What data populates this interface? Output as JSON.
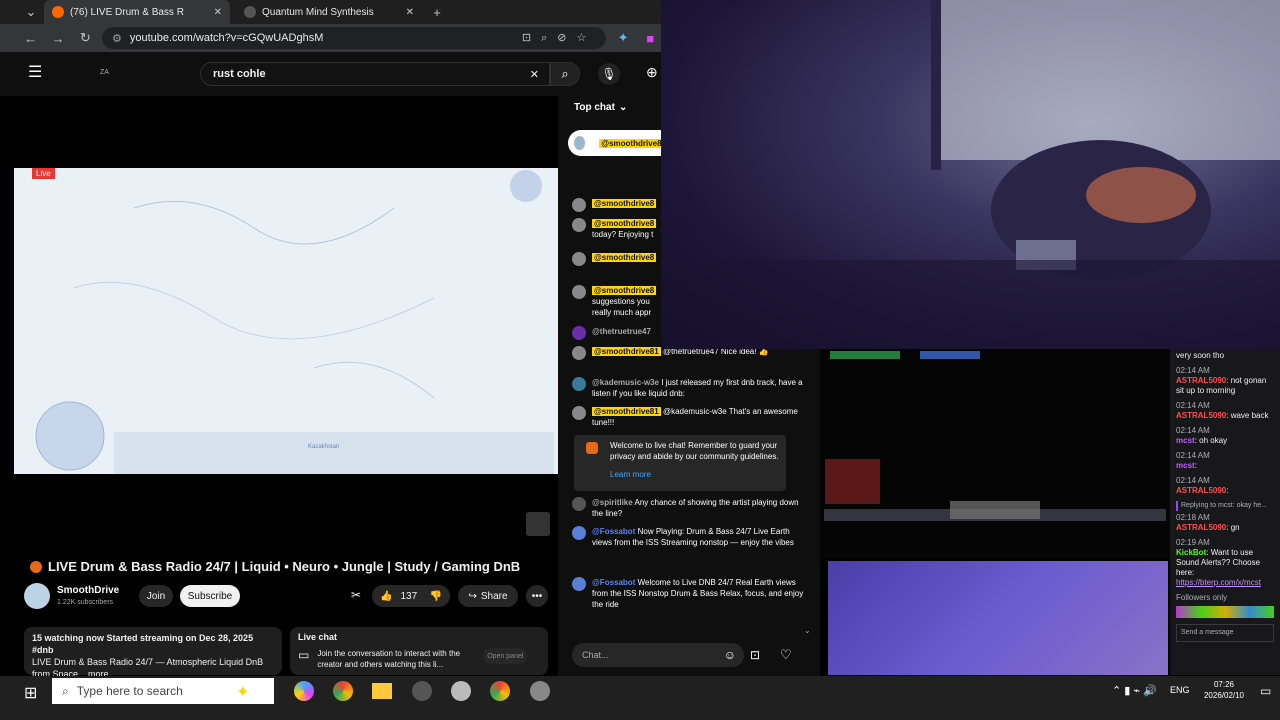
{
  "browser": {
    "tabs": [
      {
        "label": "(76) LIVE Drum & Bass R",
        "active": true
      },
      {
        "label": "Quantum Mind Synthesis",
        "active": false
      }
    ],
    "url": "youtube.com/watch?v=cGQwUADghsM"
  },
  "youtube": {
    "search_value": "rust cohle",
    "live_badge": "Live",
    "title": "LIVE Drum & Bass Radio 24/7 | Liquid • Neuro • Jungle | Study / Gaming DnB",
    "channel_name": "SmoothDrive",
    "subscribers": "1.22K subscribers",
    "join_label": "Join",
    "subscribe_label": "Subscribe",
    "likes": "137",
    "share_label": "Share",
    "description_line1": "15 watching now  Started streaming on Dec 28, 2025  #dnb",
    "description_line2": "LIVE Drum & Bass Radio 24/7 — Atmospheric Liquid DnB",
    "description_line3": "from Space  ...more",
    "live_chat_title": "Live chat",
    "live_chat_text": "Join the conversation to interact with the creator and others watching this li...",
    "live_chat_button": "Open panel",
    "map_label": "Kazakhstan"
  },
  "chat": {
    "header": "Top chat",
    "input_placeholder": "Chat...",
    "pinned_name": "@smoothdrive81",
    "messages": [
      {
        "name": "@smoothdrive8",
        "text": "",
        "hl": true
      },
      {
        "name": "@smoothdrive8",
        "text": "today? Enjoying t",
        "hl": true
      },
      {
        "name": "@smoothdrive8",
        "text": "",
        "hl": true
      },
      {
        "name": "@smoothdrive8",
        "text": "suggestions you really much appr",
        "hl": true
      },
      {
        "name": "@thetruetrue47",
        "text": "",
        "hl": false
      },
      {
        "name": "@smoothdrive81",
        "text": "@thetruetrue47 Nice idea! 👍",
        "hl": true
      },
      {
        "name": "@kademusic-w3e",
        "text": "I just released my first dnb track, have a listen if you like liquid dnb:",
        "hl": false
      },
      {
        "name": "@smoothdrive81",
        "text": "@kademusic-w3e That's an awesome tune!!!",
        "hl": true
      }
    ],
    "welcome_text": "Welcome to live chat! Remember to guard your privacy and abide by our community guidelines.",
    "learn_more": "Learn more",
    "late_messages": [
      {
        "name": "@spiritlike",
        "text": "Any chance of showing the artist playing down the line?"
      },
      {
        "name": "@Fossabot",
        "text": "Now Playing: Drum & Bass 24/7  Live Earth views from the ISS  Streaming nonstop — enjoy the vibes"
      },
      {
        "name": "@Fossabot",
        "text": "Welcome to Live DNB 24/7 Real Earth views from the ISS  Nonstop Drum & Bass  Relax, focus, and enjoy the ride"
      }
    ]
  },
  "twitch": {
    "top_text": "very soon tho",
    "messages": [
      {
        "time": "02:14 AM",
        "name": "ASTRAL5090",
        "text": "not gonan sit up to morning",
        "color": "#ff4f4f"
      },
      {
        "time": "02:14 AM",
        "name": "ASTRAL5090",
        "text": "wave back",
        "color": "#ff4f4f"
      },
      {
        "time": "02:14 AM",
        "name": "mcst",
        "text": "oh okay",
        "color": "#c05cff"
      },
      {
        "time": "02:14 AM",
        "name": "mcst",
        "text": "",
        "color": "#c05cff"
      },
      {
        "time": "02:14 AM",
        "name": "ASTRAL5090",
        "text": "",
        "color": "#ff4f4f"
      }
    ],
    "reply_label": "Replying to mcst: okay he...",
    "reply_time": "02:18 AM",
    "reply_name": "ASTRAL5090",
    "reply_text": "gn",
    "kick_time": "02:19 AM",
    "kick_name": "KickBot",
    "kick_text": "Want to use Sound Alerts?? Choose here:",
    "kick_link": "https://bterp.com/x/mcst",
    "followers_only": "Followers only",
    "send_placeholder": "Send a message"
  },
  "taskbar": {
    "search_placeholder": "Type here to search",
    "language": "ENG",
    "time": "07:26",
    "date": "2026/02/10"
  },
  "colors": {
    "youtube_red": "#e53935",
    "highlight_yellow": "#ffd600",
    "twitch_bg": "#18181b"
  }
}
